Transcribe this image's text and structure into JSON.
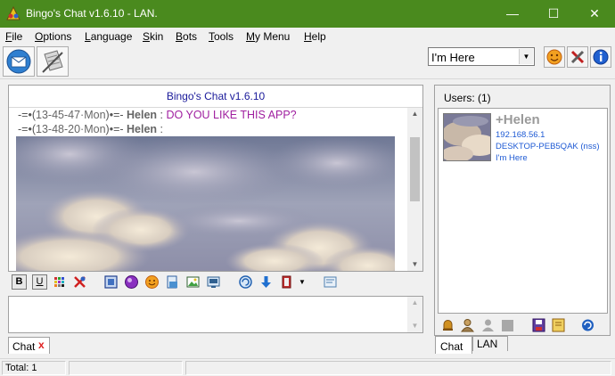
{
  "window": {
    "title": "Bingo's Chat v1.6.10 - LAN.",
    "minimize": "—",
    "maximize": "☐",
    "close": "✕"
  },
  "menu": [
    {
      "label": "File",
      "key": "F",
      "rest": "ile"
    },
    {
      "label": "Options",
      "key": "O",
      "rest": "ptions"
    },
    {
      "label": "Language",
      "key": "L",
      "rest": "anguage"
    },
    {
      "label": "Skin",
      "key": "S",
      "rest": "kin"
    },
    {
      "label": "Bots",
      "key": "B",
      "rest": "ots"
    },
    {
      "label": "Tools",
      "key": "T",
      "rest": "ools"
    },
    {
      "label": "My Menu",
      "key": "M",
      "rest": "y Menu"
    },
    {
      "label": "Help",
      "key": "H",
      "rest": "elp"
    }
  ],
  "toolbar": {
    "icons": [
      "send-message-icon",
      "notes-icon"
    ],
    "status_value": "I'm Here",
    "right_icons": [
      "smiley-icon",
      "tools-icon",
      "info-icon"
    ]
  },
  "chat": {
    "header": "Bingo's Chat v1.6.10",
    "messages": [
      {
        "prefix": "-=•(",
        "time": "13-45-47·Mon",
        "mid": ")•=- ",
        "user": "Helen",
        "sep": " : ",
        "text": "DO YOU LIKE THIS APP?"
      },
      {
        "prefix": "-=•(",
        "time": "13-48-20·Mon",
        "mid": ")•=- ",
        "user": "Helen",
        "sep": " :",
        "text": ""
      }
    ]
  },
  "format_toolbar": {
    "bold": "B",
    "underline": "U"
  },
  "tabs": {
    "chat_label": "Chat",
    "chat_close": "x",
    "users_chat": "Chat",
    "users_lan": "LAN"
  },
  "users": {
    "header": "Users: (1)",
    "list": [
      {
        "name": "+Helen",
        "ip": "192.168.56.1",
        "host": "DESKTOP-PEB5QAK (nss)",
        "status": "I'm Here"
      }
    ]
  },
  "statusbar": {
    "total": "Total: 1"
  },
  "colors": {
    "titlebar": "#4a8a1e",
    "message_text": "#a020a0",
    "user_info": "#1e5ad4",
    "chat_header": "#1a1a9a"
  }
}
